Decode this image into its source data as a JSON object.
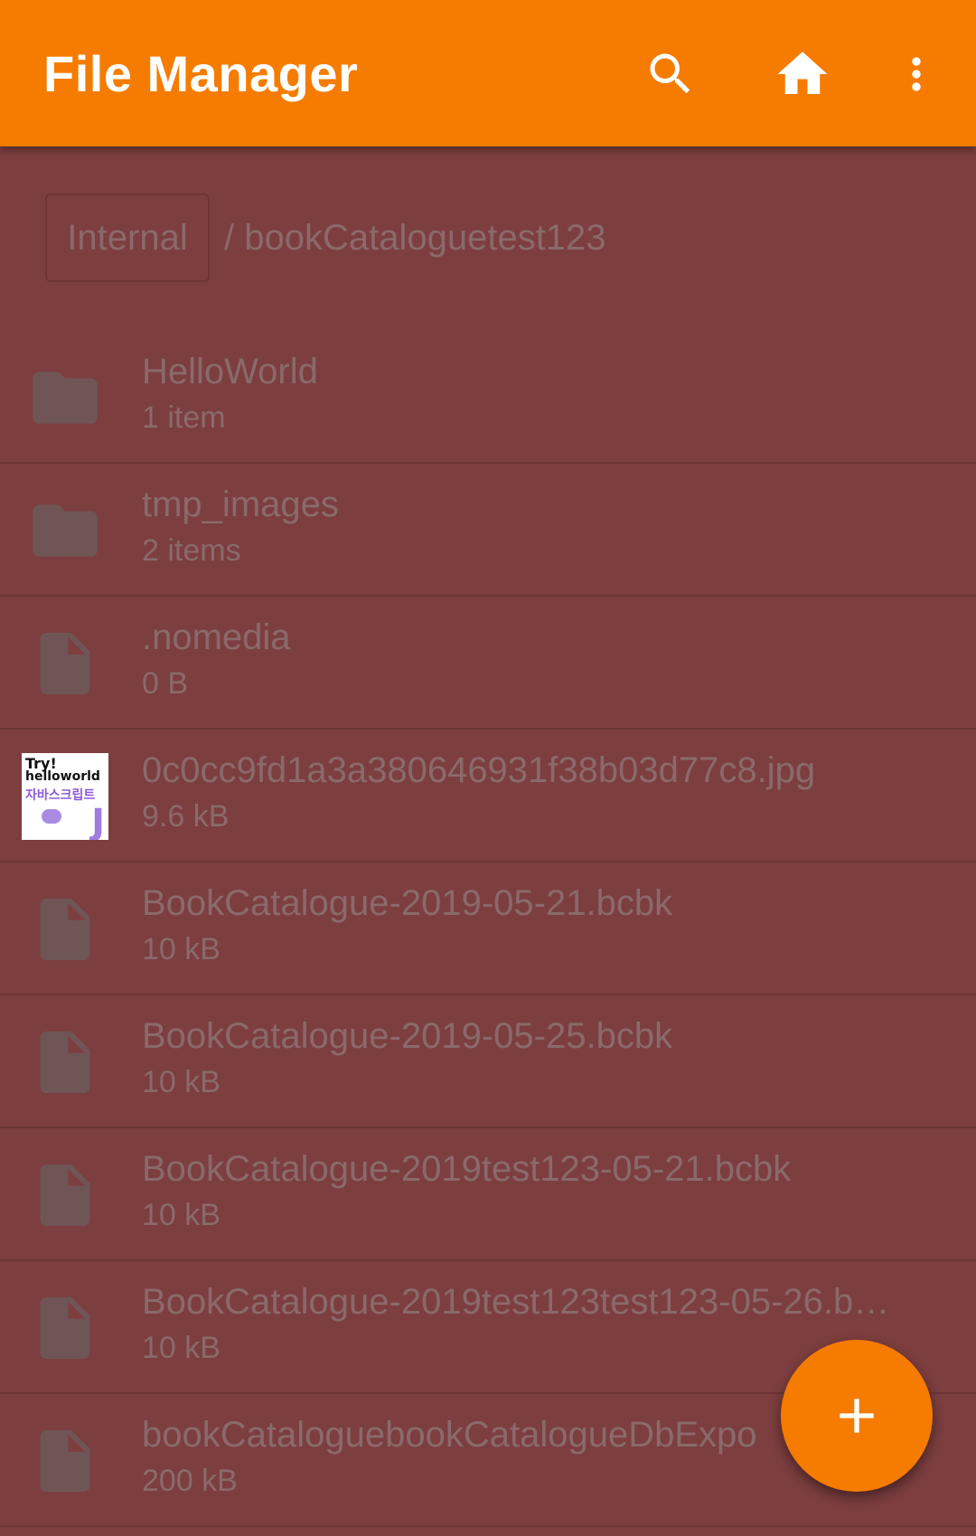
{
  "colors": {
    "toolbar": "#f57c00",
    "background_dim": "#7d3e3f",
    "text_dim": "#8a6a6a",
    "icon_dim": "#6f5556",
    "fab": "#f57c00"
  },
  "toolbar": {
    "title": "File Manager",
    "search_icon": "search-icon",
    "home_icon": "home-icon",
    "more_icon": "more-vert-icon"
  },
  "breadcrumb": {
    "root": "Internal",
    "path": "/ bookCataloguetest123"
  },
  "files": [
    {
      "name": "HelloWorld",
      "meta": "1 item",
      "icon": "folder-icon"
    },
    {
      "name": "tmp_images",
      "meta": "2 items",
      "icon": "folder-icon"
    },
    {
      "name": ".nomedia",
      "meta": "0 B",
      "icon": "file-icon"
    },
    {
      "name": "0c0cc9fd1a3a380646931f38b03d77c8.jpg",
      "meta": "9.6 kB",
      "icon": "image-thumbnail",
      "thumbnail": {
        "line1": "Try!",
        "line2": "helloworld",
        "line3": "자바스크립트",
        "mark": "J"
      }
    },
    {
      "name": "BookCatalogue-2019-05-21.bcbk",
      "meta": "10 kB",
      "icon": "file-icon"
    },
    {
      "name": "BookCatalogue-2019-05-25.bcbk",
      "meta": "10 kB",
      "icon": "file-icon"
    },
    {
      "name": "BookCatalogue-2019test123-05-21.bcbk",
      "meta": "10 kB",
      "icon": "file-icon"
    },
    {
      "name": "BookCatalogue-2019test123test123-05-26.b…",
      "meta": "10 kB",
      "icon": "file-icon"
    },
    {
      "name": "bookCataloguebookCatalogueDbExpo",
      "meta": "200 kB",
      "icon": "file-icon"
    }
  ],
  "fab": {
    "icon": "add-icon"
  }
}
